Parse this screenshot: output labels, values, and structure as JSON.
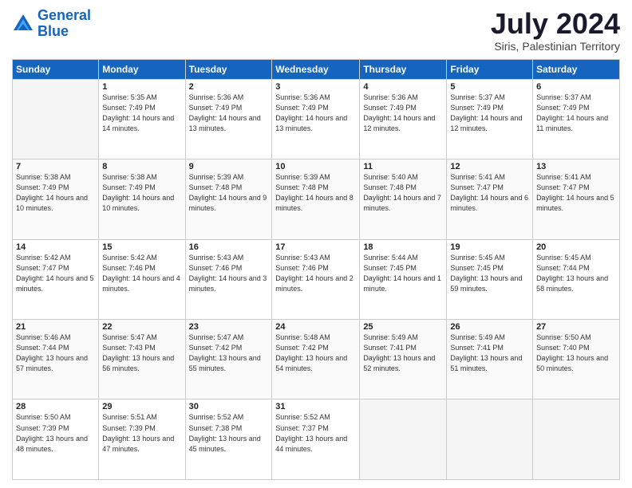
{
  "header": {
    "logo_line1": "General",
    "logo_line2": "Blue",
    "month": "July 2024",
    "location": "Siris, Palestinian Territory"
  },
  "days_of_week": [
    "Sunday",
    "Monday",
    "Tuesday",
    "Wednesday",
    "Thursday",
    "Friday",
    "Saturday"
  ],
  "weeks": [
    [
      {
        "day": "",
        "empty": true
      },
      {
        "day": "1",
        "sunrise": "Sunrise: 5:35 AM",
        "sunset": "Sunset: 7:49 PM",
        "daylight": "Daylight: 14 hours and 14 minutes."
      },
      {
        "day": "2",
        "sunrise": "Sunrise: 5:36 AM",
        "sunset": "Sunset: 7:49 PM",
        "daylight": "Daylight: 14 hours and 13 minutes."
      },
      {
        "day": "3",
        "sunrise": "Sunrise: 5:36 AM",
        "sunset": "Sunset: 7:49 PM",
        "daylight": "Daylight: 14 hours and 13 minutes."
      },
      {
        "day": "4",
        "sunrise": "Sunrise: 5:36 AM",
        "sunset": "Sunset: 7:49 PM",
        "daylight": "Daylight: 14 hours and 12 minutes."
      },
      {
        "day": "5",
        "sunrise": "Sunrise: 5:37 AM",
        "sunset": "Sunset: 7:49 PM",
        "daylight": "Daylight: 14 hours and 12 minutes."
      },
      {
        "day": "6",
        "sunrise": "Sunrise: 5:37 AM",
        "sunset": "Sunset: 7:49 PM",
        "daylight": "Daylight: 14 hours and 11 minutes."
      }
    ],
    [
      {
        "day": "7",
        "sunrise": "Sunrise: 5:38 AM",
        "sunset": "Sunset: 7:49 PM",
        "daylight": "Daylight: 14 hours and 10 minutes."
      },
      {
        "day": "8",
        "sunrise": "Sunrise: 5:38 AM",
        "sunset": "Sunset: 7:49 PM",
        "daylight": "Daylight: 14 hours and 10 minutes."
      },
      {
        "day": "9",
        "sunrise": "Sunrise: 5:39 AM",
        "sunset": "Sunset: 7:48 PM",
        "daylight": "Daylight: 14 hours and 9 minutes."
      },
      {
        "day": "10",
        "sunrise": "Sunrise: 5:39 AM",
        "sunset": "Sunset: 7:48 PM",
        "daylight": "Daylight: 14 hours and 8 minutes."
      },
      {
        "day": "11",
        "sunrise": "Sunrise: 5:40 AM",
        "sunset": "Sunset: 7:48 PM",
        "daylight": "Daylight: 14 hours and 7 minutes."
      },
      {
        "day": "12",
        "sunrise": "Sunrise: 5:41 AM",
        "sunset": "Sunset: 7:47 PM",
        "daylight": "Daylight: 14 hours and 6 minutes."
      },
      {
        "day": "13",
        "sunrise": "Sunrise: 5:41 AM",
        "sunset": "Sunset: 7:47 PM",
        "daylight": "Daylight: 14 hours and 5 minutes."
      }
    ],
    [
      {
        "day": "14",
        "sunrise": "Sunrise: 5:42 AM",
        "sunset": "Sunset: 7:47 PM",
        "daylight": "Daylight: 14 hours and 5 minutes."
      },
      {
        "day": "15",
        "sunrise": "Sunrise: 5:42 AM",
        "sunset": "Sunset: 7:46 PM",
        "daylight": "Daylight: 14 hours and 4 minutes."
      },
      {
        "day": "16",
        "sunrise": "Sunrise: 5:43 AM",
        "sunset": "Sunset: 7:46 PM",
        "daylight": "Daylight: 14 hours and 3 minutes."
      },
      {
        "day": "17",
        "sunrise": "Sunrise: 5:43 AM",
        "sunset": "Sunset: 7:46 PM",
        "daylight": "Daylight: 14 hours and 2 minutes."
      },
      {
        "day": "18",
        "sunrise": "Sunrise: 5:44 AM",
        "sunset": "Sunset: 7:45 PM",
        "daylight": "Daylight: 14 hours and 1 minute."
      },
      {
        "day": "19",
        "sunrise": "Sunrise: 5:45 AM",
        "sunset": "Sunset: 7:45 PM",
        "daylight": "Daylight: 13 hours and 59 minutes."
      },
      {
        "day": "20",
        "sunrise": "Sunrise: 5:45 AM",
        "sunset": "Sunset: 7:44 PM",
        "daylight": "Daylight: 13 hours and 58 minutes."
      }
    ],
    [
      {
        "day": "21",
        "sunrise": "Sunrise: 5:46 AM",
        "sunset": "Sunset: 7:44 PM",
        "daylight": "Daylight: 13 hours and 57 minutes."
      },
      {
        "day": "22",
        "sunrise": "Sunrise: 5:47 AM",
        "sunset": "Sunset: 7:43 PM",
        "daylight": "Daylight: 13 hours and 56 minutes."
      },
      {
        "day": "23",
        "sunrise": "Sunrise: 5:47 AM",
        "sunset": "Sunset: 7:42 PM",
        "daylight": "Daylight: 13 hours and 55 minutes."
      },
      {
        "day": "24",
        "sunrise": "Sunrise: 5:48 AM",
        "sunset": "Sunset: 7:42 PM",
        "daylight": "Daylight: 13 hours and 54 minutes."
      },
      {
        "day": "25",
        "sunrise": "Sunrise: 5:49 AM",
        "sunset": "Sunset: 7:41 PM",
        "daylight": "Daylight: 13 hours and 52 minutes."
      },
      {
        "day": "26",
        "sunrise": "Sunrise: 5:49 AM",
        "sunset": "Sunset: 7:41 PM",
        "daylight": "Daylight: 13 hours and 51 minutes."
      },
      {
        "day": "27",
        "sunrise": "Sunrise: 5:50 AM",
        "sunset": "Sunset: 7:40 PM",
        "daylight": "Daylight: 13 hours and 50 minutes."
      }
    ],
    [
      {
        "day": "28",
        "sunrise": "Sunrise: 5:50 AM",
        "sunset": "Sunset: 7:39 PM",
        "daylight": "Daylight: 13 hours and 48 minutes."
      },
      {
        "day": "29",
        "sunrise": "Sunrise: 5:51 AM",
        "sunset": "Sunset: 7:39 PM",
        "daylight": "Daylight: 13 hours and 47 minutes."
      },
      {
        "day": "30",
        "sunrise": "Sunrise: 5:52 AM",
        "sunset": "Sunset: 7:38 PM",
        "daylight": "Daylight: 13 hours and 45 minutes."
      },
      {
        "day": "31",
        "sunrise": "Sunrise: 5:52 AM",
        "sunset": "Sunset: 7:37 PM",
        "daylight": "Daylight: 13 hours and 44 minutes."
      },
      {
        "day": "",
        "empty": true
      },
      {
        "day": "",
        "empty": true
      },
      {
        "day": "",
        "empty": true
      }
    ]
  ]
}
